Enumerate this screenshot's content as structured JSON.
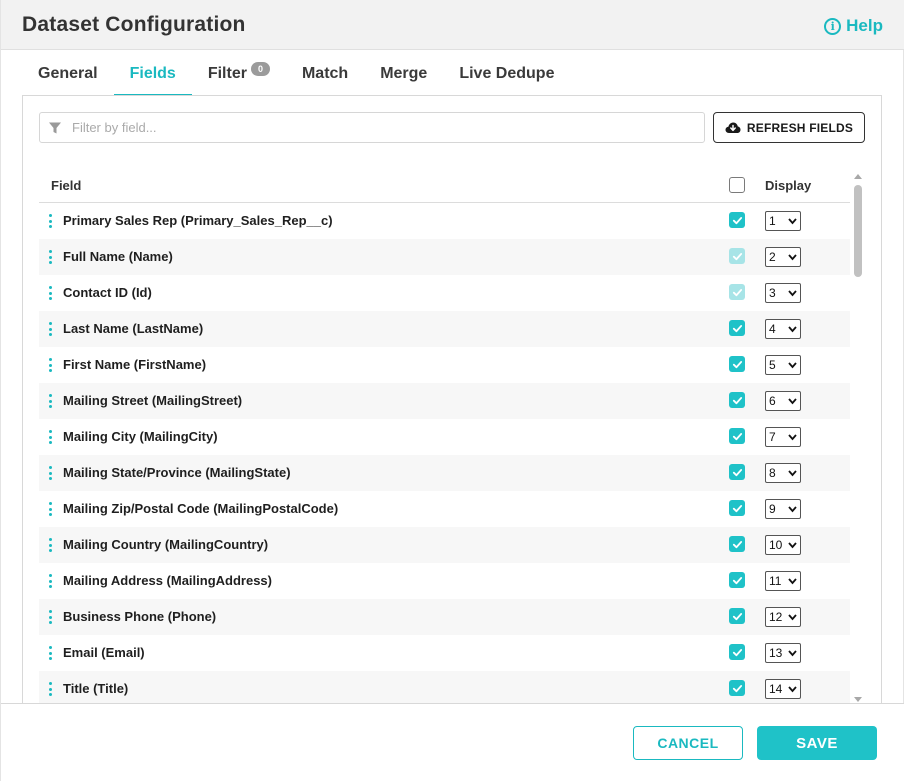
{
  "dialog": {
    "title": "Dataset Configuration",
    "help_label": "Help",
    "help_icon": "info-circle-icon"
  },
  "tabs": [
    {
      "label": "General",
      "active": false
    },
    {
      "label": "Fields",
      "active": true
    },
    {
      "label": "Filter",
      "active": false,
      "badge": "0"
    },
    {
      "label": "Match",
      "active": false
    },
    {
      "label": "Merge",
      "active": false
    },
    {
      "label": "Live Dedupe",
      "active": false
    }
  ],
  "filter": {
    "placeholder": "Filter by field...",
    "value": "",
    "icon": "funnel-icon"
  },
  "refresh_button": {
    "label": "REFRESH FIELDS",
    "icon": "cloud-download-icon"
  },
  "table": {
    "headers": {
      "field": "Field",
      "display": "Display"
    },
    "select_all_checked": false,
    "rows": [
      {
        "label": "Primary Sales Rep (Primary_Sales_Rep__c)",
        "checked": true,
        "disabled": false,
        "display": "1"
      },
      {
        "label": "Full Name (Name)",
        "checked": true,
        "disabled": true,
        "display": "2"
      },
      {
        "label": "Contact ID (Id)",
        "checked": true,
        "disabled": true,
        "display": "3"
      },
      {
        "label": "Last Name (LastName)",
        "checked": true,
        "disabled": false,
        "display": "4"
      },
      {
        "label": "First Name (FirstName)",
        "checked": true,
        "disabled": false,
        "display": "5"
      },
      {
        "label": "Mailing Street (MailingStreet)",
        "checked": true,
        "disabled": false,
        "display": "6"
      },
      {
        "label": "Mailing City (MailingCity)",
        "checked": true,
        "disabled": false,
        "display": "7"
      },
      {
        "label": "Mailing State/Province (MailingState)",
        "checked": true,
        "disabled": false,
        "display": "8"
      },
      {
        "label": "Mailing Zip/Postal Code (MailingPostalCode)",
        "checked": true,
        "disabled": false,
        "display": "9"
      },
      {
        "label": "Mailing Country (MailingCountry)",
        "checked": true,
        "disabled": false,
        "display": "10"
      },
      {
        "label": "Mailing Address (MailingAddress)",
        "checked": true,
        "disabled": false,
        "display": "11"
      },
      {
        "label": "Business Phone (Phone)",
        "checked": true,
        "disabled": false,
        "display": "12"
      },
      {
        "label": "Email (Email)",
        "checked": true,
        "disabled": false,
        "display": "13"
      },
      {
        "label": "Title (Title)",
        "checked": true,
        "disabled": false,
        "display": "14"
      }
    ]
  },
  "footer": {
    "cancel_label": "CANCEL",
    "save_label": "SAVE"
  },
  "colors": {
    "accent": "#1ab9c0",
    "checkbox": "#1fc2c8",
    "checkbox_disabled": "#a7e4e7",
    "badge": "#9b9b9b"
  }
}
